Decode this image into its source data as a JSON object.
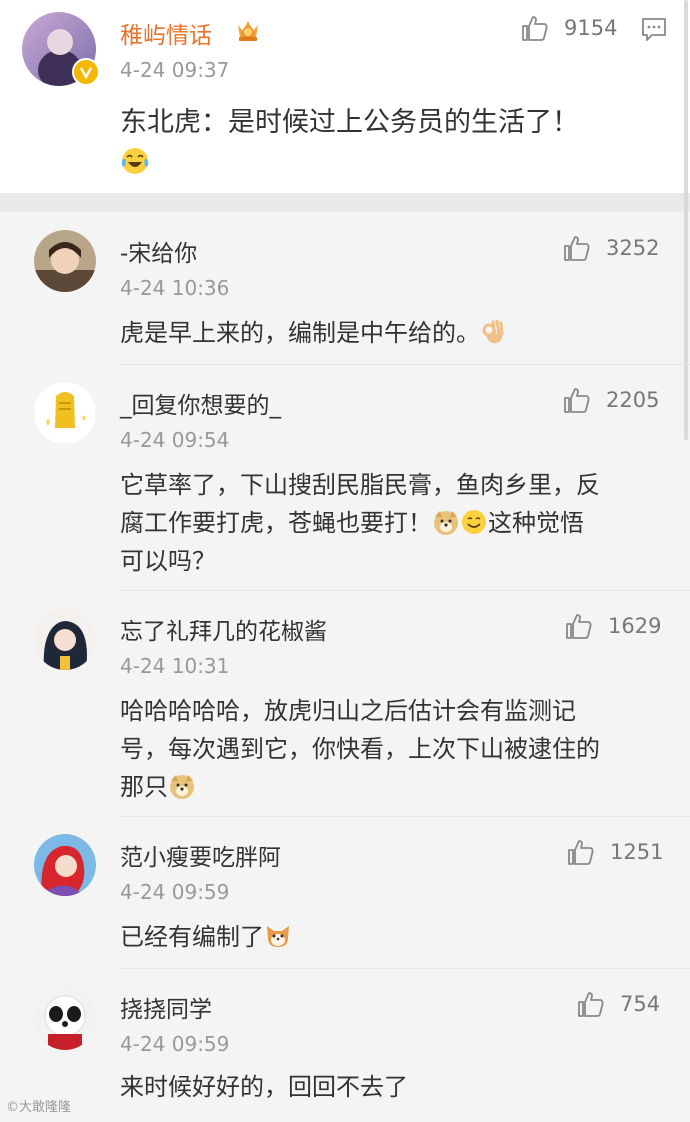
{
  "post": {
    "author": "稚屿情话",
    "time": "4-24 09:37",
    "likes": "9154",
    "text": "东北虎：是时候过上公务员的生活了！",
    "emoji": "laughing-crying-face"
  },
  "comments": [
    {
      "user": "-宋给你",
      "time": "4-24 10:36",
      "likes": "3252",
      "text": "虎是早上来的，编制是中午给的。"
    },
    {
      "user": "_回复你想要的_",
      "time": "4-24 09:54",
      "likes": "2205",
      "lines": [
        "它草率了，下山搜刮民脂民膏，鱼肉乡里，反",
        "腐工作要打虎，苍蝇也要打！",
        "这种觉悟",
        "可以吗？"
      ]
    },
    {
      "user": "忘了礼拜几的花椒酱",
      "time": "4-24 10:31",
      "likes": "1629",
      "lines": [
        "哈哈哈哈哈，放虎归山之后估计会有监测记",
        "号，每次遇到它，你快看，上次下山被逮住的",
        "那只"
      ]
    },
    {
      "user": "范小瘦要吃胖阿",
      "time": "4-24 09:59",
      "likes": "1251",
      "text": "已经有编制了"
    },
    {
      "user": "挠挠同学",
      "time": "4-24 09:59",
      "likes": "754",
      "text": "来时候好好的，回回不去了"
    }
  ],
  "watermark": "©大敢隆隆",
  "colors": {
    "op_name": "#e6752b",
    "background": "#f4f4f4",
    "post_bg": "#ffffff"
  }
}
